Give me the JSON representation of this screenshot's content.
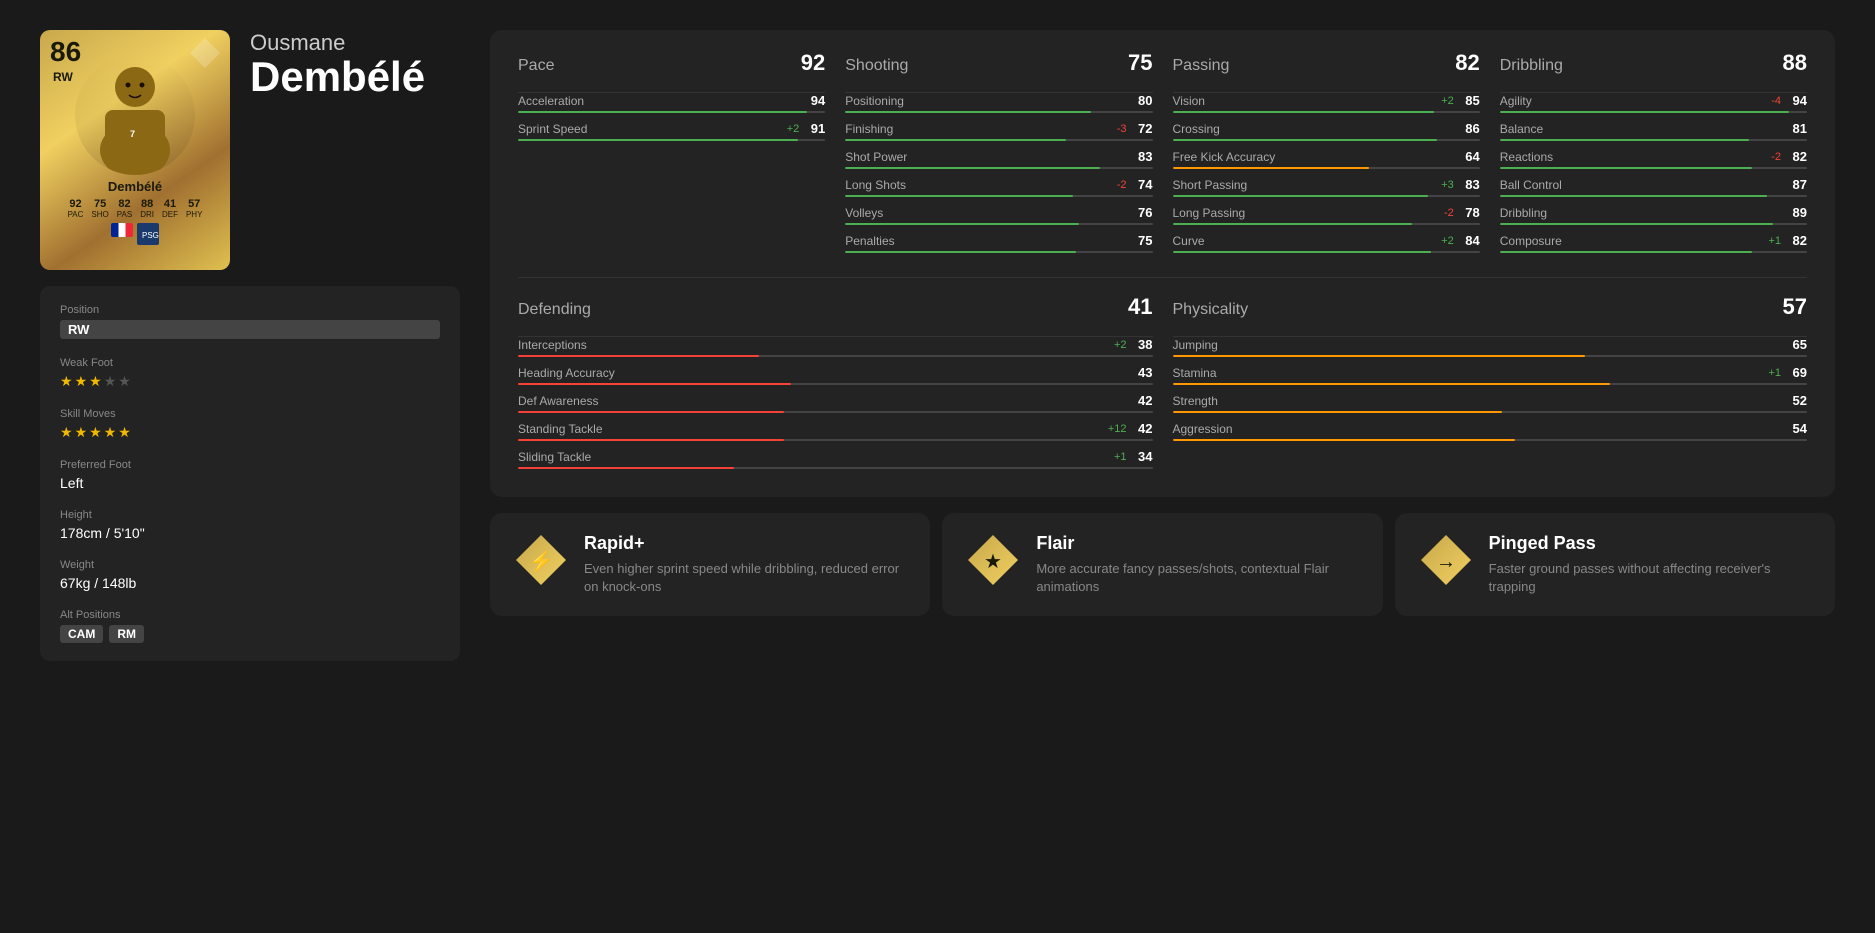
{
  "player": {
    "first_name": "Ousmane",
    "last_name": "Dembélé",
    "card_name": "Dembélé",
    "rating": "86",
    "position": "RW",
    "card_stats": {
      "PAC": "92",
      "SHO": "75",
      "PAS": "82",
      "DRI": "88",
      "DEF": "41",
      "PHY": "57"
    }
  },
  "info": {
    "position_label": "Position",
    "position_value": "RW",
    "weak_foot_label": "Weak Foot",
    "weak_foot_stars": 3,
    "skill_moves_label": "Skill Moves",
    "skill_moves_stars": 5,
    "preferred_foot_label": "Preferred Foot",
    "preferred_foot_value": "Left",
    "height_label": "Height",
    "height_value": "178cm / 5'10\"",
    "weight_label": "Weight",
    "weight_value": "67kg / 148lb",
    "alt_positions_label": "Alt Positions",
    "alt_positions": [
      "CAM",
      "RM"
    ]
  },
  "stats": {
    "pace": {
      "name": "Pace",
      "value": 92,
      "items": [
        {
          "name": "Acceleration",
          "value": 94,
          "modifier": "",
          "bar_pct": 94
        },
        {
          "name": "Sprint Speed",
          "value": 91,
          "modifier": "+2",
          "bar_pct": 91
        }
      ]
    },
    "shooting": {
      "name": "Shooting",
      "value": 75,
      "items": [
        {
          "name": "Positioning",
          "value": 80,
          "modifier": "",
          "bar_pct": 80
        },
        {
          "name": "Finishing",
          "value": 72,
          "modifier": "-3",
          "bar_pct": 72
        },
        {
          "name": "Shot Power",
          "value": 83,
          "modifier": "",
          "bar_pct": 83
        },
        {
          "name": "Long Shots",
          "value": 74,
          "modifier": "-2",
          "bar_pct": 74
        },
        {
          "name": "Volleys",
          "value": 76,
          "modifier": "",
          "bar_pct": 76
        },
        {
          "name": "Penalties",
          "value": 75,
          "modifier": "",
          "bar_pct": 75
        }
      ]
    },
    "passing": {
      "name": "Passing",
      "value": 82,
      "items": [
        {
          "name": "Vision",
          "value": 85,
          "modifier": "+2",
          "bar_pct": 85
        },
        {
          "name": "Crossing",
          "value": 86,
          "modifier": "",
          "bar_pct": 86
        },
        {
          "name": "Free Kick Accuracy",
          "value": 64,
          "modifier": "",
          "bar_pct": 64
        },
        {
          "name": "Short Passing",
          "value": 83,
          "modifier": "+3",
          "bar_pct": 83
        },
        {
          "name": "Long Passing",
          "value": 78,
          "modifier": "-2",
          "bar_pct": 78
        },
        {
          "name": "Curve",
          "value": 84,
          "modifier": "+2",
          "bar_pct": 84
        }
      ]
    },
    "dribbling": {
      "name": "Dribbling",
      "value": 88,
      "items": [
        {
          "name": "Agility",
          "value": 94,
          "modifier": "-4",
          "bar_pct": 94
        },
        {
          "name": "Balance",
          "value": 81,
          "modifier": "",
          "bar_pct": 81
        },
        {
          "name": "Reactions",
          "value": 82,
          "modifier": "-2",
          "bar_pct": 82
        },
        {
          "name": "Ball Control",
          "value": 87,
          "modifier": "",
          "bar_pct": 87
        },
        {
          "name": "Dribbling",
          "value": 89,
          "modifier": "",
          "bar_pct": 89
        },
        {
          "name": "Composure",
          "value": 82,
          "modifier": "+1",
          "bar_pct": 82
        }
      ]
    },
    "defending": {
      "name": "Defending",
      "value": 41,
      "items": [
        {
          "name": "Interceptions",
          "value": 38,
          "modifier": "+2",
          "bar_pct": 38
        },
        {
          "name": "Heading Accuracy",
          "value": 43,
          "modifier": "",
          "bar_pct": 43
        },
        {
          "name": "Def Awareness",
          "value": 42,
          "modifier": "",
          "bar_pct": 42
        },
        {
          "name": "Standing Tackle",
          "value": 42,
          "modifier": "+12",
          "bar_pct": 42
        },
        {
          "name": "Sliding Tackle",
          "value": 34,
          "modifier": "+1",
          "bar_pct": 34
        }
      ]
    },
    "physicality": {
      "name": "Physicality",
      "value": 57,
      "items": [
        {
          "name": "Jumping",
          "value": 65,
          "modifier": "",
          "bar_pct": 65
        },
        {
          "name": "Stamina",
          "value": 69,
          "modifier": "+1",
          "bar_pct": 69
        },
        {
          "name": "Strength",
          "value": 52,
          "modifier": "",
          "bar_pct": 52
        },
        {
          "name": "Aggression",
          "value": 54,
          "modifier": "",
          "bar_pct": 54
        }
      ]
    }
  },
  "playstyles": [
    {
      "icon": "⚡",
      "name": "Rapid+",
      "description": "Even higher sprint speed while dribbling, reduced error on knock-ons"
    },
    {
      "icon": "★",
      "name": "Flair",
      "description": "More accurate fancy passes/shots, contextual Flair animations"
    },
    {
      "icon": "→",
      "name": "Pinged Pass",
      "description": "Faster ground passes without affecting receiver's trapping"
    }
  ]
}
